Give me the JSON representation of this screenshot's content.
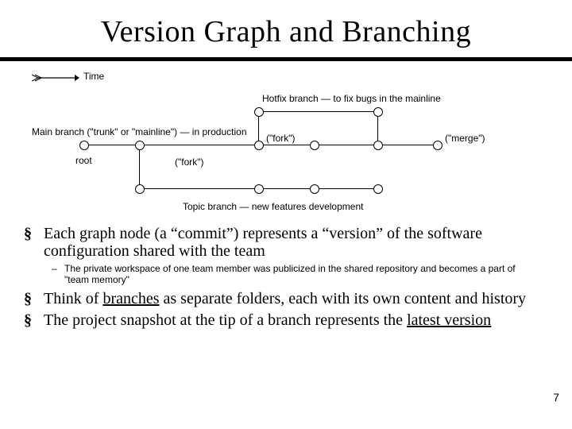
{
  "title": "Version Graph and Branching",
  "diagram": {
    "time": "Time",
    "hotfix": "Hotfix branch — to fix bugs in the mainline",
    "main": "Main branch (\"trunk\" or \"mainline\") — in production",
    "fork1": "(\"fork\")",
    "merge": "(\"merge\")",
    "root": "root",
    "fork2": "(\"fork\")",
    "topic": "Topic branch — new features development"
  },
  "bullets": {
    "b1": "Each graph node (a “commit”) represents a “version” of the software configuration shared with the team",
    "sub": "The private workspace of one team member was publicized in the shared repository and becomes a part of \"team memory\"",
    "b2_pre": "Think of ",
    "b2_u": "branches",
    "b2_post": " as separate folders, each with its own content and history",
    "b3_pre": "The project snapshot at the tip of a branch represents the ",
    "b3_u": "latest version"
  },
  "page": "7"
}
